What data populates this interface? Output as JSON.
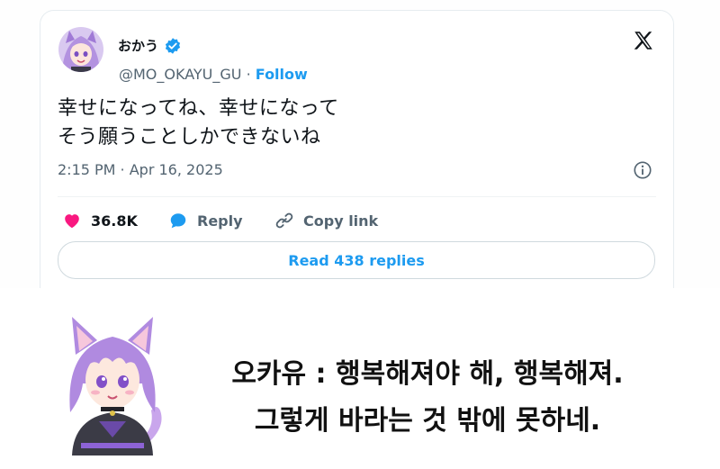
{
  "tweet": {
    "display_name": "おかう",
    "handle": "@MO_OKAYU_GU",
    "separator": "·",
    "follow_label": "Follow",
    "text_lines": [
      "幸せになってね、幸せになって",
      "そう願うことしかできないね"
    ],
    "timestamp": "2:15 PM · Apr 16, 2025",
    "likes_count": "36.8K",
    "reply_label": "Reply",
    "copy_link_label": "Copy link",
    "read_replies_label": "Read 438 replies"
  },
  "caption": {
    "lines": [
      "오카유 : 행복해져야 해, 행복해져.",
      "그렇게 바라는 것 밖에 못하네."
    ]
  },
  "colors": {
    "accent": "#1d9bf0",
    "like": "#f91880",
    "muted": "#536471",
    "text": "#0f1419"
  },
  "icons": {
    "verified": "verified-badge-icon",
    "x_logo": "x-logo-icon",
    "info": "info-icon",
    "like": "heart-icon",
    "reply": "speech-bubble-icon",
    "copy_link": "link-icon"
  }
}
